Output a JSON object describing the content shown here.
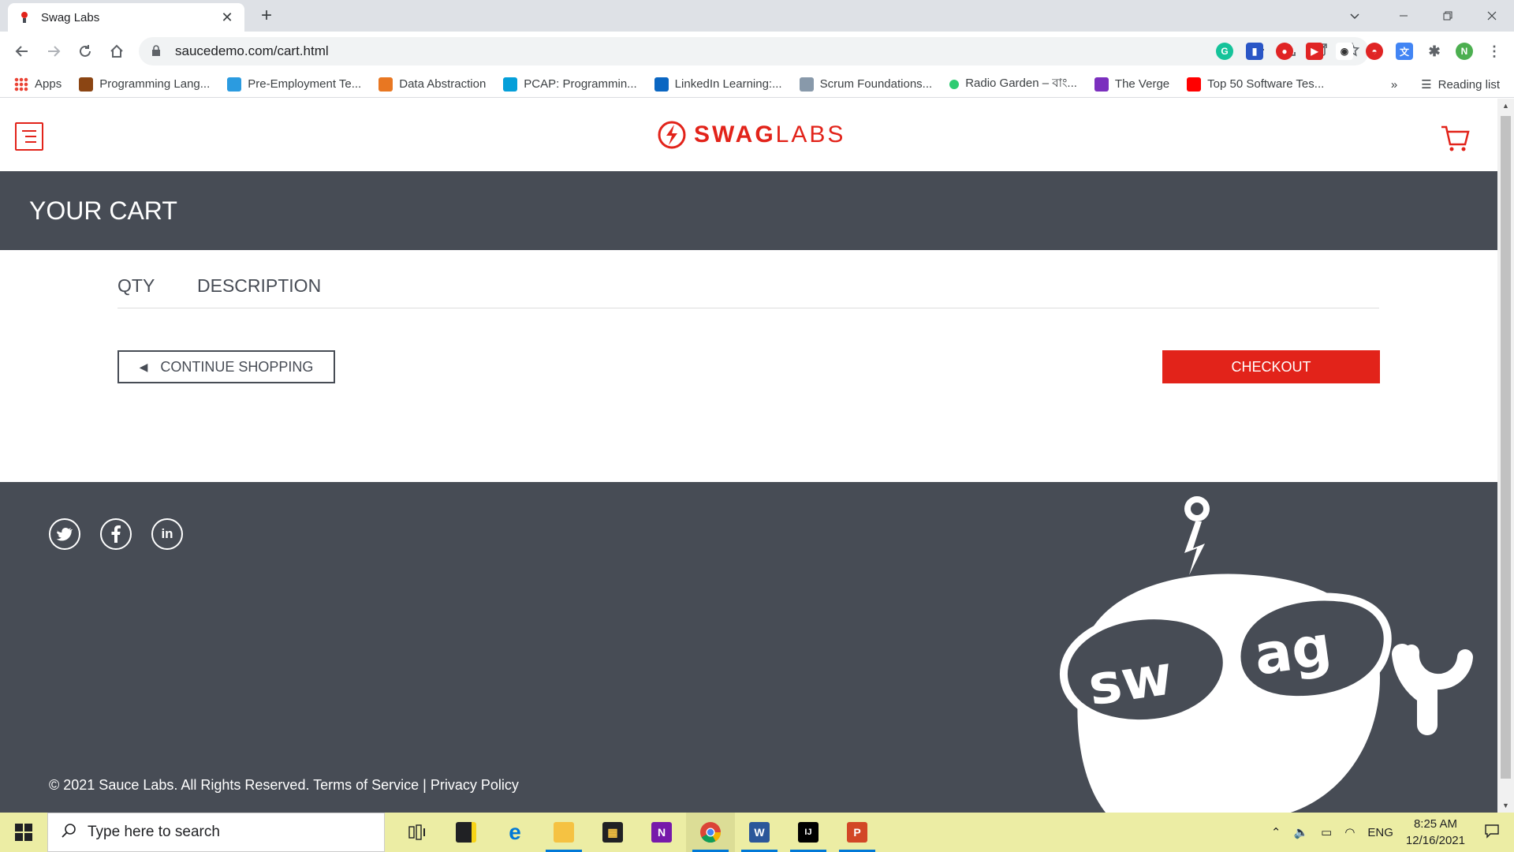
{
  "browser": {
    "tab_title": "Swag Labs",
    "url": "saucedemo.com/cart.html",
    "bookmarks": [
      {
        "label": "Apps",
        "color": "#4285f4"
      },
      {
        "label": "Programming Lang...",
        "color": "#8b4513"
      },
      {
        "label": "Pre-Employment Te...",
        "color": "#2b9be0"
      },
      {
        "label": "Data Abstraction",
        "color": "#e87722"
      },
      {
        "label": "PCAP: Programmin...",
        "color": "#049fd9"
      },
      {
        "label": "LinkedIn Learning:...",
        "color": "#0a66c2"
      },
      {
        "label": "Scrum Foundations...",
        "color": "#8899aa"
      },
      {
        "label": "Radio Garden – বাং...",
        "color": "#2ecc71"
      },
      {
        "label": "The Verge",
        "color": "#7b2fbe"
      },
      {
        "label": "Top 50 Software Tes...",
        "color": "#ff0000"
      }
    ],
    "reading_list": "Reading list",
    "profile_initial": "N"
  },
  "app": {
    "logo_bold": "SWAG",
    "logo_light": "LABS",
    "page_title": "YOUR CART",
    "qty_label": "QTY",
    "description_label": "DESCRIPTION",
    "continue_label": "CONTINUE SHOPPING",
    "checkout_label": "CHECKOUT",
    "copyright": "© 2021 Sauce Labs. All Rights Reserved. Terms of Service | Privacy Policy",
    "robot_text_left": "sw",
    "robot_text_right": "ag",
    "colors": {
      "accent": "#e2231a",
      "dark": "#474c55"
    }
  },
  "taskbar": {
    "search_placeholder": "Type here to search",
    "language": "ENG",
    "time": "8:25 AM",
    "date": "12/16/2021"
  }
}
